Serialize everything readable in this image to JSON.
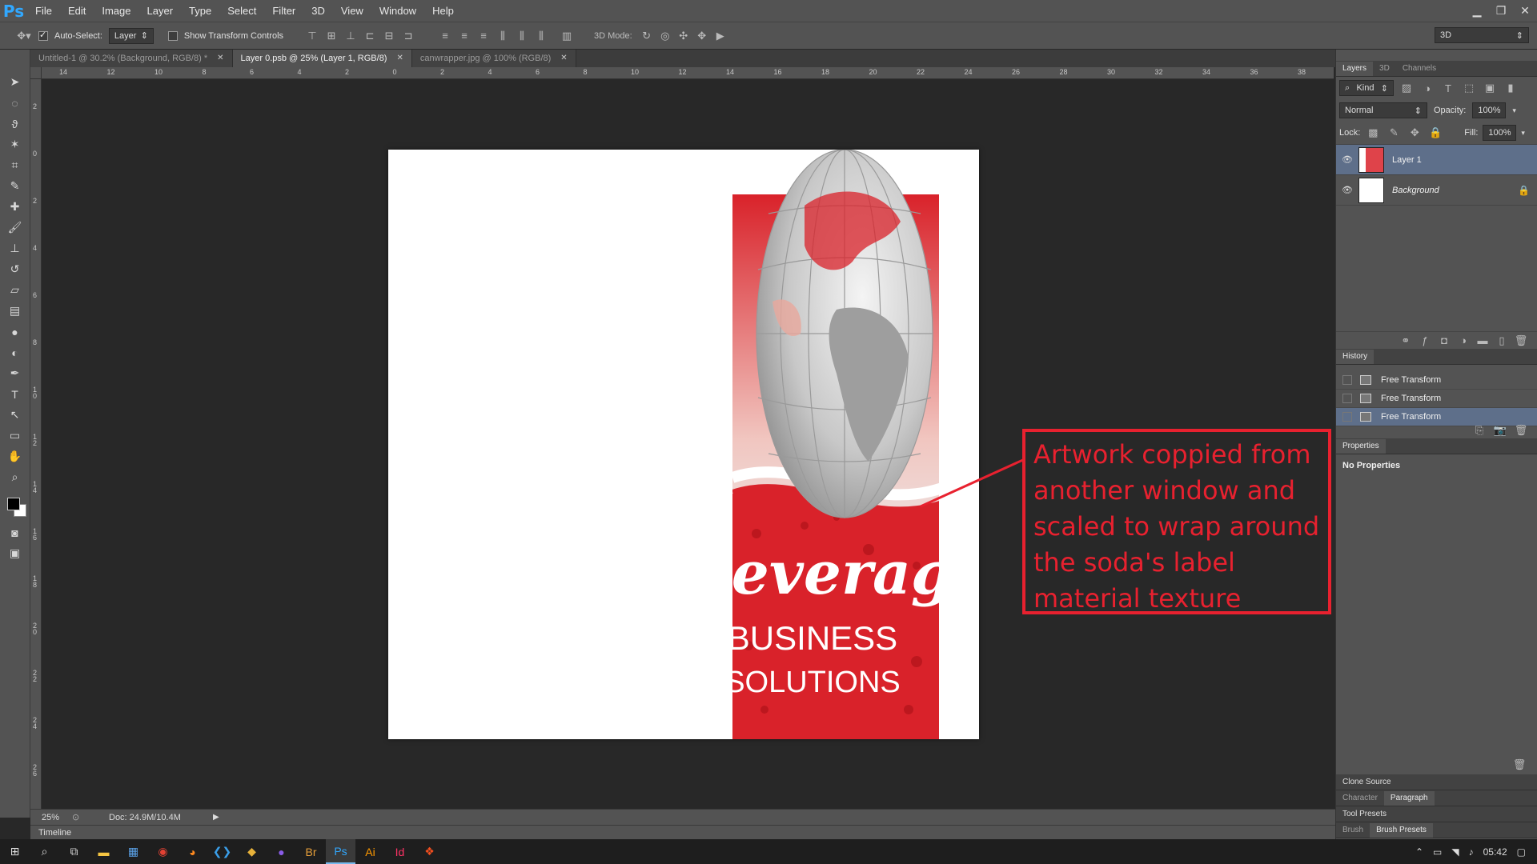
{
  "app": {
    "logo": "Ps",
    "menu": [
      "File",
      "Edit",
      "Image",
      "Layer",
      "Type",
      "Select",
      "Filter",
      "3D",
      "View",
      "Window",
      "Help"
    ]
  },
  "options": {
    "auto_select_label": "Auto-Select:",
    "auto_select_value": "Layer",
    "show_transform_label": "Show Transform Controls",
    "mode_3d_label": "3D Mode:",
    "workspace_value": "3D"
  },
  "tabs": [
    {
      "label": "Untitled-1 @ 30.2% (Background, RGB/8) *"
    },
    {
      "label": "Layer 0.psb @ 25% (Layer 1, RGB/8)"
    },
    {
      "label": "canwrapper.jpg @ 100% (RGB/8)"
    }
  ],
  "ruler_h": [
    "14",
    "12",
    "10",
    "8",
    "6",
    "4",
    "2",
    "0",
    "2",
    "4",
    "6",
    "8",
    "10",
    "12",
    "14",
    "16",
    "18",
    "20",
    "22",
    "24",
    "26",
    "28",
    "30",
    "32",
    "34",
    "36",
    "38"
  ],
  "ruler_v": [
    "2",
    "0",
    "2",
    "4",
    "6",
    "8",
    "1\n0",
    "1\n2",
    "1\n4",
    "1\n6",
    "1\n8",
    "2\n0",
    "2\n2",
    "2\n4",
    "2\n6"
  ],
  "status": {
    "zoom": "25%",
    "doc": "Doc: 24.9M/10.4M",
    "timeline": "Timeline"
  },
  "artwork": {
    "brand_script": "Beverage",
    "line2": "BUSINESS",
    "line3": "SOLUTIONS",
    "colors": {
      "red": "#d9222a",
      "white": "#ffffff",
      "grey": "#b5b5b5"
    }
  },
  "layers_panel": {
    "tabs": [
      "Layers",
      "3D",
      "Channels"
    ],
    "kind_label": "Kind",
    "blend_mode": "Normal",
    "opacity_label": "Opacity:",
    "opacity_value": "100%",
    "lock_label": "Lock:",
    "fill_label": "Fill:",
    "fill_value": "100%",
    "layers": [
      {
        "name": "Layer 1",
        "selected": true
      },
      {
        "name": "Background",
        "selected": false
      }
    ]
  },
  "history_panel": {
    "title": "History",
    "items": [
      {
        "label": "Free Transform"
      },
      {
        "label": "Free Transform"
      },
      {
        "label": "Free Transform"
      }
    ]
  },
  "properties_panel": {
    "title": "Properties",
    "body": "No Properties"
  },
  "collapsed_panels": {
    "clone_source": "Clone Source",
    "character": "Character",
    "paragraph": "Paragraph",
    "tool_presets": "Tool Presets",
    "brush": "Brush",
    "brush_presets": "Brush Presets"
  },
  "annotation": {
    "text": "Artwork coppied from another window and scaled to wrap around the soda's label material texture",
    "color": "#e8212f"
  },
  "taskbar": {
    "time": "05:42"
  }
}
